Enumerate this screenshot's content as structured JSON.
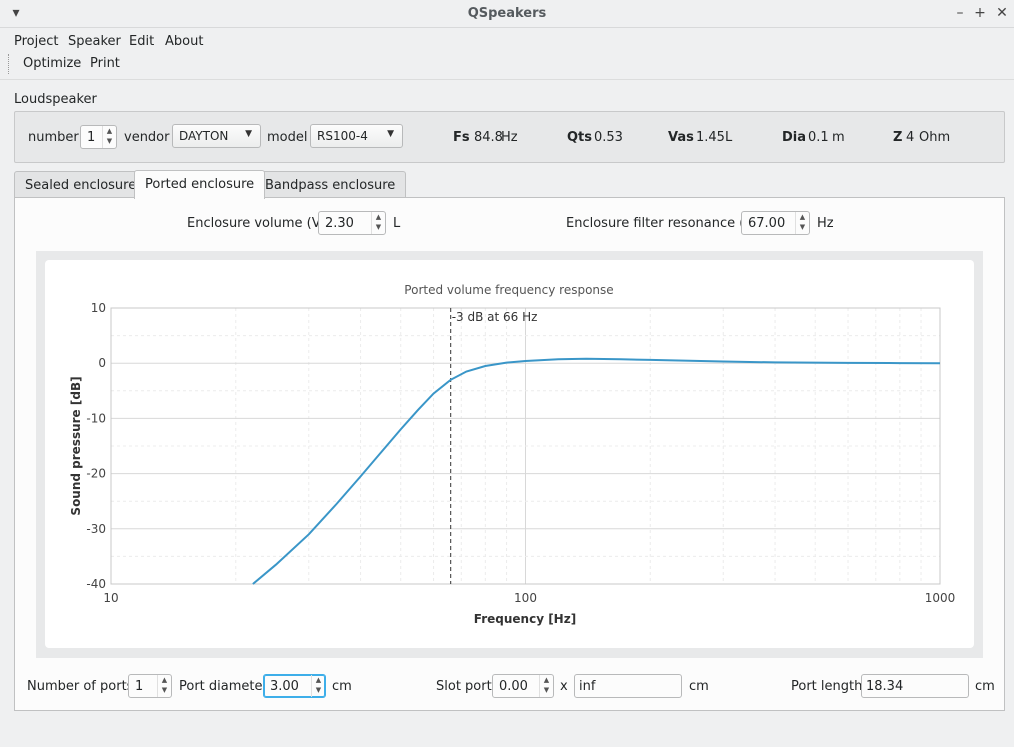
{
  "window": {
    "title": "QSpeakers"
  },
  "menu": {
    "items": [
      "Project",
      "Speaker",
      "Edit",
      "About"
    ]
  },
  "toolbar": {
    "optimize": "Optimize",
    "print": "Print"
  },
  "loudspeaker": {
    "group_label": "Loudspeaker",
    "number_label": "number",
    "number_value": "1",
    "vendor_label": "vendor",
    "vendor_value": "DAYTON",
    "model_label": "model",
    "model_value": "RS100-4",
    "params": [
      {
        "name": "Fs",
        "value": "84.8",
        "unit": "Hz"
      },
      {
        "name": "Qts",
        "value": "0.53",
        "unit": ""
      },
      {
        "name": "Vas",
        "value": "1.45",
        "unit": "L"
      },
      {
        "name": "Dia",
        "value": "0.1",
        "unit": "m"
      },
      {
        "name": "Z",
        "value": "4",
        "unit": "Ohm"
      }
    ]
  },
  "tabs": [
    "Sealed enclosure",
    "Ported enclosure",
    "Bandpass enclosure"
  ],
  "active_tab": 1,
  "ported": {
    "vb_label": "Enclosure volume (Vb)",
    "vb_value": "2.30",
    "vb_unit": "L",
    "fb_label": "Enclosure filter resonance (Fb)",
    "fb_value": "67.00",
    "fb_unit": "Hz",
    "ports_label": "Number of ports",
    "ports_value": "1",
    "diameter_label": "Port diameter",
    "diameter_value": "3.00",
    "diameter_unit": "cm",
    "slot_label": "Slot port",
    "slot_value": "0.00",
    "slot_x": "x",
    "slot_height": "inf",
    "slot_unit": "cm",
    "length_label": "Port length",
    "length_value": "18.34",
    "length_unit": "cm"
  },
  "colors": {
    "curve": "#3a96c8",
    "grid": "#e0e0e0",
    "focus": "#3daee9"
  },
  "chart_data": {
    "type": "line",
    "title": "Ported volume frequency response",
    "xlabel": "Frequency [Hz]",
    "ylabel": "Sound pressure [dB]",
    "xscale": "log",
    "xlim": [
      10,
      1000
    ],
    "ylim": [
      -40,
      10
    ],
    "xticks": [
      "10",
      "100",
      "1000"
    ],
    "yticks": [
      "10",
      "0",
      "-10",
      "-20",
      "-30",
      "-40"
    ],
    "grid": true,
    "annotation": {
      "label": "-3 dB at 66 Hz",
      "x": 66
    },
    "series": [
      {
        "x": [
          22,
          25,
          30,
          35,
          40,
          45,
          50,
          55,
          60,
          66,
          72,
          80,
          90,
          100,
          120,
          140,
          170,
          200,
          300,
          400,
          600,
          800,
          1000
        ],
        "y": [
          -40,
          -36.5,
          -31,
          -25.5,
          -20.5,
          -16,
          -12,
          -8.5,
          -5.5,
          -3,
          -1.5,
          -0.5,
          0.1,
          0.4,
          0.7,
          0.8,
          0.7,
          0.6,
          0.3,
          0.15,
          0.05,
          0.02,
          0
        ]
      }
    ]
  }
}
